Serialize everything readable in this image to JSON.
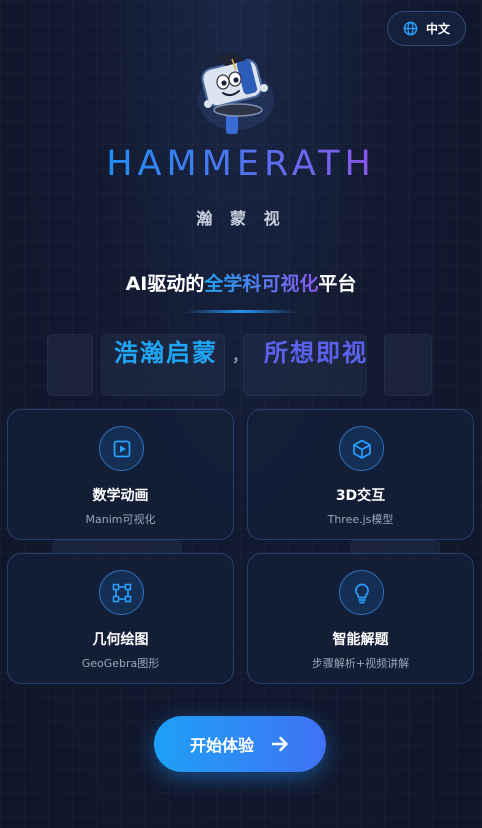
{
  "header": {
    "language_label": "中文",
    "globe_icon": "globe-icon"
  },
  "brand": {
    "name": "HAMMERATH",
    "chinese_name": "瀚 蒙 视"
  },
  "tagline": {
    "prefix": "AI驱动的",
    "highlight": "全学科可视化",
    "suffix": "平台"
  },
  "motto": {
    "part1": "浩瀚启蒙",
    "separator": "，",
    "part2": "所想即视"
  },
  "features": [
    {
      "title": "数学动画",
      "subtitle": "Manim可视化",
      "icon": "play-square-icon"
    },
    {
      "title": "3D交互",
      "subtitle": "Three.js模型",
      "icon": "cube-icon"
    },
    {
      "title": "几何绘图",
      "subtitle": "GeoGebra图形",
      "icon": "geometry-square-icon"
    },
    {
      "title": "智能解题",
      "subtitle": "步骤解析+视频讲解",
      "icon": "lightbulb-icon"
    }
  ],
  "cta": {
    "label": "开始体验",
    "icon": "arrow-right-icon"
  },
  "colors": {
    "accent_blue": "#1fa6f5",
    "accent_purple": "#8a56ea",
    "background": "#121a30",
    "card_border": "#23436e"
  }
}
